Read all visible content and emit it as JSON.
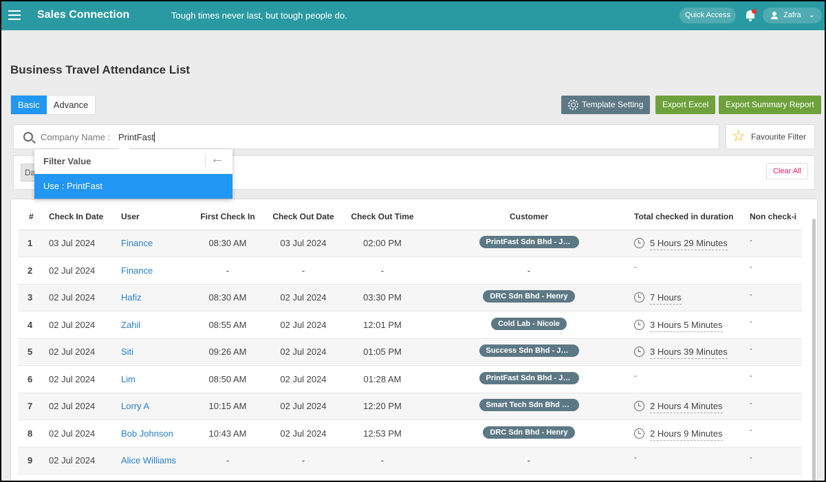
{
  "header": {
    "brand": "Sales Connection",
    "motto": "Tough times never last, but tough people do.",
    "quick_access": "Quick Access",
    "user": "Zafra",
    "colors": {
      "header": "#2a9aa2",
      "primary": "#2196f3",
      "export": "#6ea13c",
      "pill": "#5d7885"
    }
  },
  "page": {
    "title": "Business Travel Attendance List"
  },
  "tabs": [
    {
      "label": "Basic",
      "active": true
    },
    {
      "label": "Advance",
      "active": false
    }
  ],
  "toolbar": {
    "template": "Template Setting",
    "export_excel": "Export Excel",
    "export_summary": "Export Summary Report"
  },
  "search": {
    "label": "Company Name :",
    "value": "PrintFast",
    "favourite": "Favourite Filter",
    "chip": "Da",
    "clear_all": "Clear All"
  },
  "dropdown": {
    "header": "Filter Value",
    "option": "Use : PrintFast"
  },
  "table": {
    "columns": [
      "#",
      "Check In Date",
      "User",
      "First Check In",
      "Check Out Date",
      "Check Out Time",
      "Customer",
      "Total checked in duration",
      "Non check-i"
    ],
    "rows": [
      [
        "1",
        "03 Jul 2024",
        "Finance",
        "08:30 AM",
        "03 Jul 2024",
        "02:00 PM",
        "PrintFast Sdn Bhd - Joh...",
        "5 Hours 29 Minutes",
        "-"
      ],
      [
        "2",
        "02 Jul 2024",
        "Finance",
        "-",
        "-",
        "-",
        "-",
        "-",
        "-"
      ],
      [
        "3",
        "02 Jul 2024",
        "Hafiz",
        "08:30 AM",
        "02 Jul 2024",
        "03:30 PM",
        "DRC Sdn Bhd - Henry",
        "7 Hours",
        "-"
      ],
      [
        "4",
        "02 Jul 2024",
        "Zahil",
        "08:55 AM",
        "02 Jul 2024",
        "12:01 PM",
        "Cold Lab - Nicole",
        "3 Hours 5 Minutes",
        "-"
      ],
      [
        "5",
        "02 Jul 2024",
        "Siti",
        "09:26 AM",
        "02 Jul 2024",
        "01:05 PM",
        "Success Sdn Bhd - Jam...",
        "3 Hours 39 Minutes",
        "-"
      ],
      [
        "6",
        "02 Jul 2024",
        "Lim",
        "08:50 AM",
        "02 Jul 2024",
        "01:28 AM",
        "PrintFast Sdn Bhd - Joh...",
        "-",
        "-"
      ],
      [
        "7",
        "02 Jul 2024",
        "Lorry A",
        "10:15 AM",
        "02 Jul 2024",
        "12:20 PM",
        "Smart Tech Sdn Bhd - J...",
        "2 Hours 4 Minutes",
        "-"
      ],
      [
        "8",
        "02 Jul 2024",
        "Bob Johnson",
        "10:43 AM",
        "02 Jul 2024",
        "12:53 PM",
        "DRC Sdn Bhd - Henry",
        "2 Hours 9 Minutes",
        "-"
      ],
      [
        "9",
        "02 Jul 2024",
        "Alice Williams",
        "-",
        "-",
        "-",
        "-",
        "-",
        "-"
      ]
    ]
  }
}
